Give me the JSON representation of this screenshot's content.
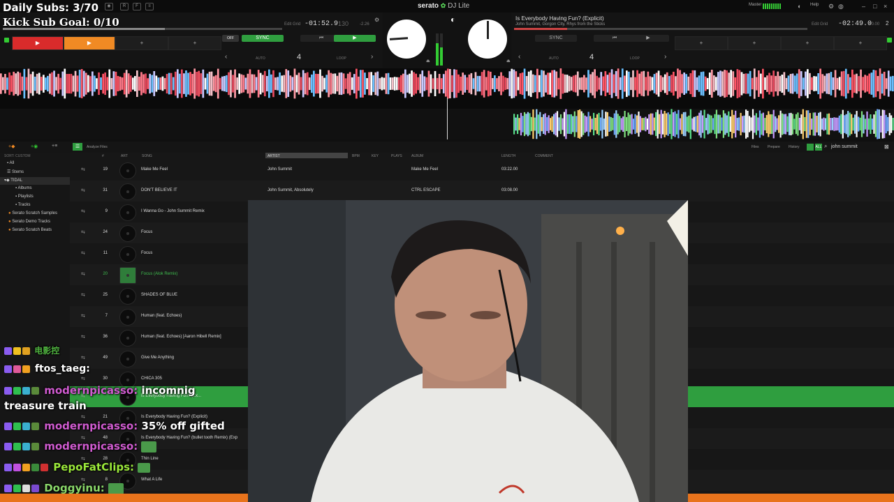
{
  "overlay": {
    "daily_subs": "Daily Subs: 3/70",
    "kick_goal": "Kick Sub Goal: 0/10"
  },
  "app": {
    "brand": "serato",
    "edition": "DJ Lite"
  },
  "topbar": {
    "master_label": "Master",
    "help_label": "Help"
  },
  "deck_left": {
    "time_remaining": "-01:52.9",
    "bpm": "130",
    "pitch": "-2.26",
    "sync_label": "SYNC",
    "off_label": "OFF",
    "auto_label": "AUTO",
    "loop_label": "LOOP",
    "loop_size": "4",
    "edit_label": "Edit Grid"
  },
  "deck_right": {
    "track_title": "Is Everybody Having Fun? (Explicit)",
    "track_artist": "John Summit, Gorgon City, Rhys from the Sticks",
    "time_remaining": "-02:49.0",
    "pitch": "+0.00",
    "deck_number": "2",
    "sync_label": "SYNC",
    "auto_label": "AUTO",
    "loop_label": "LOOP",
    "loop_size": "4",
    "edit_label": "Edit Grid"
  },
  "library_toolbar": {
    "analyze_label": "Analyze Files",
    "files_label": "Files",
    "prepare_label": "Prepare",
    "history_label": "History",
    "search_value": "john summit"
  },
  "sidebar": {
    "header": "SORT: CUSTOM",
    "items": [
      {
        "label": "All"
      },
      {
        "label": "Stems"
      },
      {
        "label": "TIDAL"
      },
      {
        "label": "Albums"
      },
      {
        "label": "Playlists"
      },
      {
        "label": "Tracks"
      },
      {
        "label": "Serato Scratch Samples"
      },
      {
        "label": "Serato Demo Tracks"
      },
      {
        "label": "Serato Scratch Beats"
      }
    ]
  },
  "columns": {
    "number": "#",
    "art": "ART",
    "song": "SONG",
    "artist": "ARTIST",
    "bpm": "BPM",
    "key": "KEY",
    "plays": "PLAYS",
    "album": "ALBUM",
    "length": "LENGTH",
    "comment": "COMMENT"
  },
  "tracks": [
    {
      "num": "19",
      "song": "Make Me Feel",
      "artist": "John Summit",
      "album": "Make Me Feel",
      "length": "03:22.00"
    },
    {
      "num": "31",
      "song": "DON'T BELIEVE IT",
      "artist": "John Summit, Absolutely",
      "album": "CTRL ESCAPE",
      "length": "03:08.00"
    },
    {
      "num": "9",
      "song": "I Wanna Go - John Summit Remix",
      "artist": "",
      "album": "",
      "length": ""
    },
    {
      "num": "24",
      "song": "Focus",
      "artist": "",
      "album": "",
      "length": ""
    },
    {
      "num": "11",
      "song": "Focus",
      "artist": "",
      "album": "",
      "length": ""
    },
    {
      "num": "20",
      "song": "Focus (Alok Remix)",
      "artist": "",
      "album": "",
      "length": ""
    },
    {
      "num": "25",
      "song": "SHADES OF BLUE",
      "artist": "",
      "album": "",
      "length": ""
    },
    {
      "num": "7",
      "song": "Human (feat. Echoes)",
      "artist": "",
      "album": "",
      "length": ""
    },
    {
      "num": "36",
      "song": "Human (feat. Echoes) [Aaron Hibell Remix]",
      "artist": "",
      "album": "",
      "length": ""
    },
    {
      "num": "49",
      "song": "Give Me Anything",
      "artist": "",
      "album": "",
      "length": ""
    },
    {
      "num": "30",
      "song": "CHICA 305",
      "artist": "",
      "album": "",
      "length": ""
    },
    {
      "num": "",
      "song": "Is Everybody Having Fun? (Ex...",
      "artist": "",
      "album": "",
      "length": ""
    },
    {
      "num": "21",
      "song": "Is Everybody Having Fun? (Explicit)",
      "artist": "",
      "album": "",
      "length": ""
    },
    {
      "num": "48",
      "song": "Is Everybody Having Fun? (bullet tooth Remix) (Exp",
      "artist": "",
      "album": "",
      "length": ""
    },
    {
      "num": "28",
      "song": "Thin Line",
      "artist": "",
      "album": "",
      "length": ""
    },
    {
      "num": "8",
      "song": "What A Life",
      "artist": "",
      "album": "",
      "length": ""
    }
  ],
  "chat": [
    {
      "user": "电影控",
      "message": "",
      "user_color": "#4fb13f"
    },
    {
      "user": "ftos_taeg:",
      "message": "",
      "user_color": "#ffffff"
    },
    {
      "user": "modernpicasso:",
      "message": "incomnig",
      "message2": "treasure train",
      "user_color": "#d05bd0"
    },
    {
      "user": "modernpicasso:",
      "message": "35% off gifted",
      "user_color": "#d05bd0"
    },
    {
      "user": "modernpicasso:",
      "message": "",
      "user_color": "#d05bd0"
    },
    {
      "user": "PepoFatClips:",
      "message": "",
      "user_color": "#9be83a"
    },
    {
      "user": "Doggyinu:",
      "message": "",
      "user_color": "#8ad86a"
    }
  ],
  "colors": {
    "accent_green": "#2f9e3f",
    "cue_red": "#d92b2b",
    "cue_orange": "#f08a24",
    "bottom_orange": "#e8731c"
  }
}
